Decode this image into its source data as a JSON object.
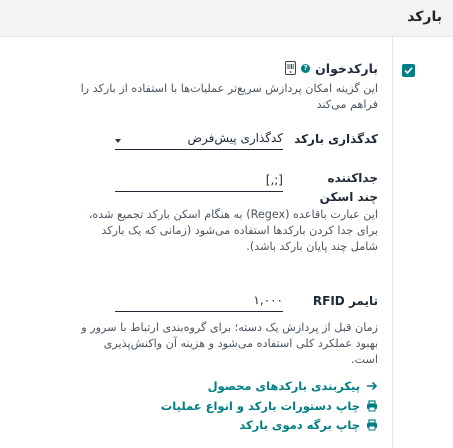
{
  "section": {
    "title": "بارکد"
  },
  "setting": {
    "title": "بارکدخوان",
    "help_mark": "?",
    "description": "این گزینه امکان پردازش سریع‌تر عملیات‌ها با استفاده از بارکد را فراهم می‌کند",
    "enabled": true
  },
  "fields": {
    "encoding": {
      "label": "کدگذاری بارکد",
      "value": "کدگذاری پیش‌فرض"
    },
    "separator": {
      "label_line1": "جداکننده",
      "label_line2": "چند اسکن",
      "value": "[,;]",
      "description": "این عبارت باقاعده (Regex) به هنگام اسکن بارکد تجمیع شده، برای جدا کردن بارکدها استفاده می‌شود (زمانی که یک بارکد شامل چند پایان بارکد باشد)."
    },
    "rfid_timer": {
      "label": "تایمر RFID",
      "value": "۱,۰۰۰",
      "description": "زمان قبل از پردازش یک دسته؛ برای گروه‌بندی ارتباط با سرور و بهبود عملکرد کلی استفاده می‌شود و هزینه آن واکنش‌پذیری است."
    }
  },
  "links": [
    {
      "label": "پیکربندی بارکدهای محصول",
      "icon": "arrow-right-icon"
    },
    {
      "label": "چاپ دستورات بارکد و انواع عملیات",
      "icon": "printer-icon"
    },
    {
      "label": "چاپ برگه دموی بارکد",
      "icon": "printer-icon"
    }
  ],
  "colors": {
    "accent": "#017e84",
    "header_bg": "#f2f3f5"
  }
}
